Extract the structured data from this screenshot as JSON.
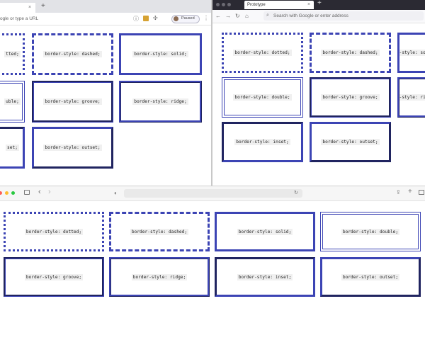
{
  "left_window": {
    "url_text": "ogle or type a URL",
    "profile_status": "Paused",
    "tab_close": "×",
    "new_tab": "+"
  },
  "right_window": {
    "tab_title": "Prototype",
    "tab_close": "×",
    "new_tab": "+",
    "url_placeholder": "Search with Google or enter address"
  },
  "bottom_window": {
    "nav_back": "‹",
    "nav_forward": "›",
    "share": "⇪",
    "new_tab": "+"
  },
  "boxes": {
    "dotted": "border-style: dotted;",
    "dashed": "border-style: dashed;",
    "solid": "border-style: solid;",
    "double": "border-style: double;",
    "groove": "border-style: groove;",
    "ridge": "border-style: ridge;",
    "inset": "border-style: inset;",
    "outset": "border-style: outset;"
  },
  "left_partial": {
    "dotted": "tted;",
    "double": "uble;",
    "inset": "set;"
  },
  "colors": {
    "border": "#3c44b4",
    "tabstrip": "#e2e3e7",
    "traffic_red": "#fe5f57",
    "traffic_yellow": "#febc2e",
    "traffic_green": "#28c840"
  }
}
